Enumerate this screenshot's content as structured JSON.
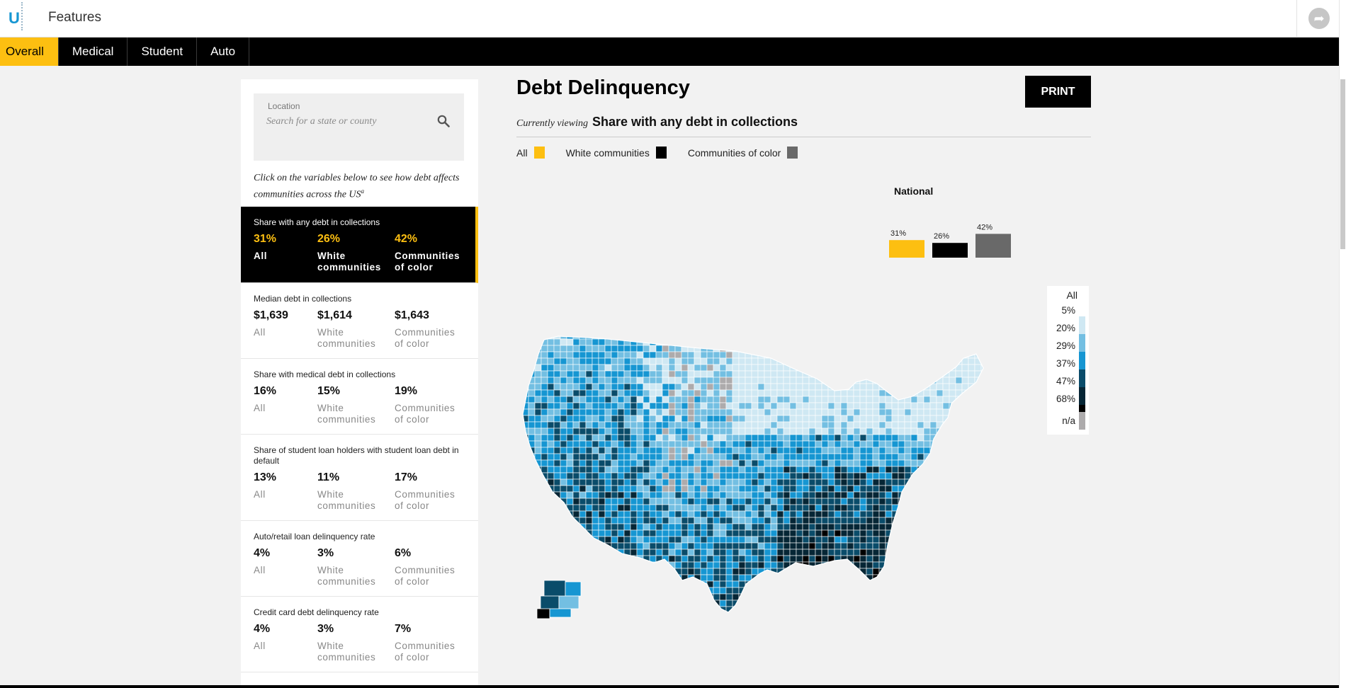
{
  "header": {
    "logo_letter": "U",
    "title": "Features"
  },
  "tabs": [
    "Overall",
    "Medical",
    "Student",
    "Auto"
  ],
  "search": {
    "label": "Location",
    "placeholder": "Search for a state or county"
  },
  "sidebar": {
    "intro": "Click on the variables below to see how debt affects communities across the US",
    "intro_note": "a",
    "metrics": [
      {
        "title": "Share with any debt in collections",
        "all": "31%",
        "white": "26%",
        "color": "42%"
      },
      {
        "title": "Median debt in collections",
        "all": "$1,639",
        "white": "$1,614",
        "color": "$1,643"
      },
      {
        "title": "Share with medical debt in collections",
        "all": "16%",
        "white": "15%",
        "color": "19%"
      },
      {
        "title": "Share of student loan holders with student loan debt in default",
        "all": "13%",
        "white": "11%",
        "color": "17%"
      },
      {
        "title": "Auto/retail loan delinquency rate",
        "all": "4%",
        "white": "3%",
        "color": "6%"
      },
      {
        "title": "Credit card debt delinquency rate",
        "all": "4%",
        "white": "3%",
        "color": "7%"
      }
    ],
    "col_labels": {
      "all": "All",
      "white_1": "White",
      "white_2": "communities",
      "color_1": "Communities",
      "color_2": "of color"
    }
  },
  "main": {
    "title": "Debt Delinquency",
    "print_label": "PRINT",
    "viewing_prefix": "Currently viewing",
    "viewing_value": "Share with any debt in collections",
    "legend": [
      {
        "label": "All",
        "color": "#fdbf11"
      },
      {
        "label": "White communities",
        "color": "#000000"
      },
      {
        "label": "Communities of color",
        "color": "#696969"
      }
    ],
    "national": {
      "title": "National",
      "bars": [
        {
          "label": "31%",
          "value": 31,
          "color": "#fdbf11"
        },
        {
          "label": "26%",
          "value": 26,
          "color": "#000000"
        },
        {
          "label": "42%",
          "value": 42,
          "color": "#696969"
        }
      ]
    }
  },
  "scale": {
    "title": "All",
    "stops": [
      "5%",
      "20%",
      "29%",
      "37%",
      "47%",
      "68%"
    ],
    "na_label": "n/a",
    "colors": [
      "#cfe8f3",
      "#73bfe2",
      "#1696d2",
      "#0a4c6a",
      "#062635",
      "#000000"
    ],
    "na_color": "#adabac"
  }
}
